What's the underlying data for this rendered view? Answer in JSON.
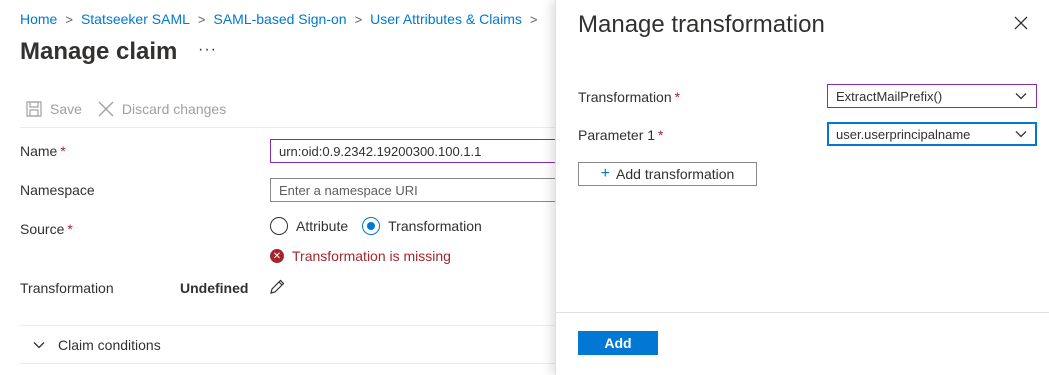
{
  "breadcrumb": [
    {
      "label": "Home"
    },
    {
      "label": "Statseeker SAML"
    },
    {
      "label": "SAML-based Sign-on"
    },
    {
      "label": "User Attributes & Claims"
    }
  ],
  "breadcrumb_separator": ">",
  "page": {
    "title": "Manage claim",
    "more_label": "···"
  },
  "toolbar": {
    "save_label": "Save",
    "discard_label": "Discard changes",
    "disabled_color": "#a19f9d"
  },
  "form": {
    "name_label": "Name",
    "name_value": "urn:oid:0.9.2342.19200300.100.1.1",
    "namespace_label": "Namespace",
    "namespace_placeholder": "Enter a namespace URI",
    "source_label": "Source",
    "source_options": [
      {
        "label": "Attribute",
        "checked": false
      },
      {
        "label": "Transformation",
        "checked": true
      }
    ],
    "error_text": "Transformation is missing",
    "transformation_label": "Transformation",
    "transformation_value": "Undefined",
    "required_marker": "*"
  },
  "claim_conditions": {
    "label": "Claim conditions"
  },
  "panel": {
    "title": "Manage transformation",
    "transformation_label": "Transformation",
    "transformation_value": "ExtractMailPrefix()",
    "parameter_label": "Parameter 1",
    "parameter_value": "user.userprincipalname",
    "add_transformation_label": "Add transformation",
    "add_button_label": "Add"
  },
  "colors": {
    "link": "#0078d4",
    "primary": "#0078d4",
    "error": "#a4262c",
    "focus_border": "#8a2ba8"
  },
  "icons": [
    "save-icon",
    "discard-icon",
    "more-icon",
    "error-icon",
    "edit-pencil-icon",
    "chevron-down-icon",
    "close-icon",
    "plus-icon"
  ]
}
